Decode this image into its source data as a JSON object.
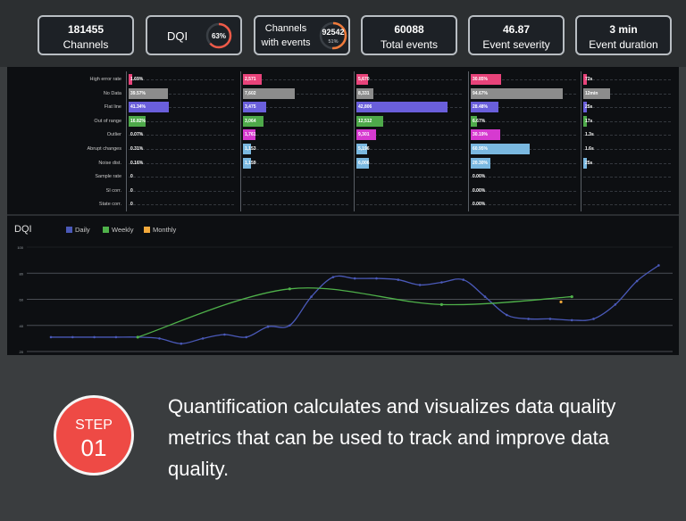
{
  "kpis": [
    {
      "value": "181455",
      "label": "Channels"
    },
    {
      "title": "DQI",
      "ring": "63%",
      "ring_fraction": 0.63,
      "ring_color": "#ef5a48"
    },
    {
      "label_l1": "Channels",
      "label_l2": "with events",
      "value": "92542",
      "ring": "51%",
      "ring_fraction": 0.51,
      "ring_color": "#ef7a3a"
    },
    {
      "value": "60088",
      "label": "Total events"
    },
    {
      "value": "46.87",
      "label": "Event severity"
    },
    {
      "value": "3 min",
      "label": "Event duration"
    }
  ],
  "table": {
    "rows": [
      "High error rate",
      "No Data",
      "Flat line",
      "Out of range",
      "Outlier",
      "Abrupt changes",
      "Noise dist.",
      "Sample rate",
      "SI corr.",
      "State corr."
    ],
    "colors": [
      "#e8437a",
      "#8c8c8c",
      "#6a5fdb",
      "#4ea94a",
      "#d63ad0",
      "#7ab8e0",
      "#7ab8e0",
      "#7ab8e0",
      "#7ab8e0",
      "#7ab8e0"
    ],
    "columns": [
      {
        "values": [
          "1.69%",
          "39.57%",
          "41.34%",
          "16.82%",
          "0.07%",
          "0.31%",
          "0.16%",
          "0",
          "0",
          "0"
        ],
        "fractions": [
          0.02,
          0.4,
          0.41,
          0.17,
          0,
          0,
          0,
          0,
          0,
          0
        ]
      },
      {
        "values": [
          "2,571",
          "7,602",
          "3,475",
          "3,064",
          "1,761",
          "1,153",
          "1,159",
          "",
          "",
          ""
        ],
        "fractions": [
          0.18,
          0.5,
          0.23,
          0.2,
          0.12,
          0.08,
          0.08,
          0,
          0,
          0
        ]
      },
      {
        "values": [
          "5,670",
          "8,331",
          "42,806",
          "12,512",
          "9,301",
          "5,196",
          "6,006",
          "",
          "",
          ""
        ],
        "fractions": [
          0.13,
          0.19,
          1.0,
          0.29,
          0.22,
          0.12,
          0.14,
          0,
          0,
          0
        ]
      },
      {
        "values": [
          "30.85%",
          "94.67%",
          "28.48%",
          "6.67%",
          "30.19%",
          "60.95%",
          "20.30%",
          "0.00%",
          "0.00%",
          "0.00%"
        ],
        "fractions": [
          0.33,
          1.0,
          0.3,
          0.07,
          0.32,
          0.64,
          0.21,
          0,
          0,
          0
        ]
      },
      {
        "values": [
          "72s",
          "12min",
          "25s",
          "17s",
          "1.3s",
          "1.6s",
          "25s",
          "",
          "",
          ""
        ],
        "fractions": [
          0.06,
          1.0,
          0.02,
          0.015,
          0,
          0,
          0.02,
          0,
          0,
          0
        ]
      }
    ]
  },
  "chart_data": {
    "type": "line",
    "title": "DQI",
    "ylim": [
      20,
      100
    ],
    "yticks": [
      "100",
      "80",
      "60",
      "40",
      "20"
    ],
    "grid": true,
    "legend": "top-left",
    "x": [
      0,
      1,
      2,
      3,
      4,
      5,
      6,
      7,
      8,
      9,
      10,
      11,
      12,
      13,
      14,
      15,
      16,
      17,
      18,
      19,
      20,
      21,
      22,
      23,
      24,
      25,
      26,
      27,
      28
    ],
    "series": [
      {
        "name": "Daily",
        "color": "#4a59b8",
        "values": [
          31,
          31,
          31,
          31,
          31,
          30,
          26,
          30,
          33,
          31,
          39,
          40,
          62,
          77,
          76,
          76,
          75,
          71,
          73,
          75,
          62,
          48,
          45,
          45,
          44,
          45,
          56,
          74,
          86
        ]
      },
      {
        "name": "Weekly",
        "color": "#4fb14a",
        "x": [
          4,
          11,
          18,
          24
        ],
        "values": [
          31,
          68,
          56,
          62
        ]
      },
      {
        "name": "Monthly",
        "color": "#f2a93b",
        "x": [
          23.5
        ],
        "values": [
          58
        ]
      }
    ]
  },
  "step": {
    "label": "STEP",
    "number": "01"
  },
  "description": "Quantification calculates and visualizes data quality metrics that can be used to track and improve data quality."
}
